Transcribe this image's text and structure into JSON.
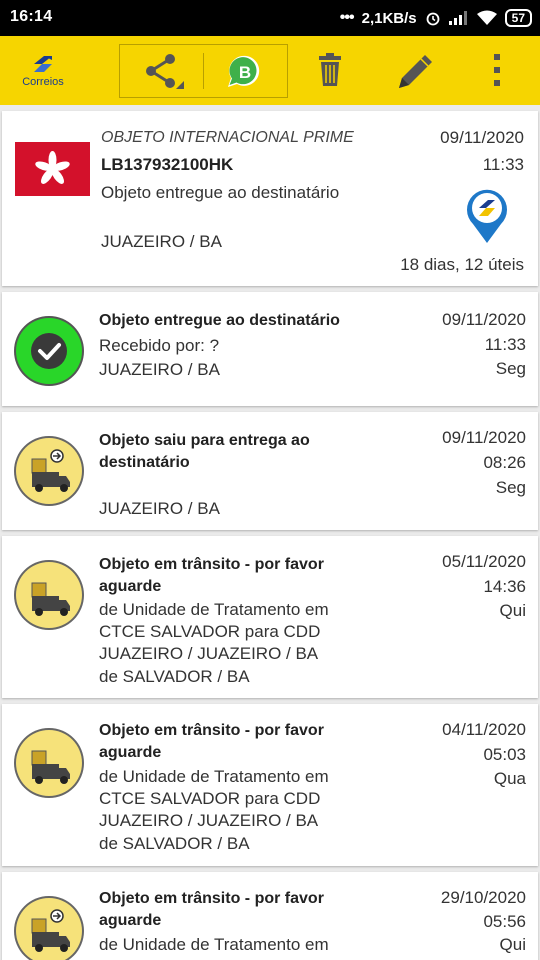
{
  "statusbar": {
    "time": "16:14",
    "network_speed": "2,1KB/s",
    "battery": "57"
  },
  "toolbar": {
    "logo_text": "Correios",
    "brand_color": "#f6d500"
  },
  "summary": {
    "category": "OBJETO INTERNACIONAL PRIME",
    "code": "LB137932100HK",
    "status": "Objeto entregue ao destinatário",
    "location": "JUAZEIRO / BA",
    "date": "09/11/2020",
    "time": "11:33",
    "duration": "18 dias, 12 úteis",
    "flag": "hong-kong-flag"
  },
  "events": [
    {
      "title": "Objeto entregue ao destinatário",
      "detail": "Recebido por: ?",
      "location": "JUAZEIRO / BA",
      "date": "09/11/2020",
      "time": "11:33",
      "day": "Seg",
      "icon": "delivered-check-icon"
    },
    {
      "title_line1": "Objeto saiu para entrega ao",
      "title_line2": "destinatário",
      "location": "JUAZEIRO / BA",
      "date": "09/11/2020",
      "time": "08:26",
      "day": "Seg",
      "icon": "delivery-truck-icon"
    },
    {
      "title_line1": "Objeto em trânsito - por favor",
      "title_line2": "aguarde",
      "detail_line1": "de Unidade de Tratamento em",
      "detail_line2": "CTCE SALVADOR para CDD",
      "detail_line3": "JUAZEIRO / JUAZEIRO / BA",
      "location": "de SALVADOR / BA",
      "date": "05/11/2020",
      "time": "14:36",
      "day": "Qui",
      "icon": "delivery-truck-icon"
    },
    {
      "title_line1": "Objeto em trânsito - por favor",
      "title_line2": "aguarde",
      "detail_line1": "de Unidade de Tratamento em",
      "detail_line2": "CTCE SALVADOR para CDD",
      "detail_line3": "JUAZEIRO / JUAZEIRO / BA",
      "location": "de SALVADOR / BA",
      "date": "04/11/2020",
      "time": "05:03",
      "day": "Qua",
      "icon": "delivery-truck-icon"
    },
    {
      "title_line1": "Objeto em trânsito - por favor",
      "title_line2": "aguarde",
      "detail_line1": "de Unidade de Tratamento em",
      "date": "29/10/2020",
      "time": "05:56",
      "day": "Qui",
      "icon": "delivery-truck-icon"
    }
  ]
}
